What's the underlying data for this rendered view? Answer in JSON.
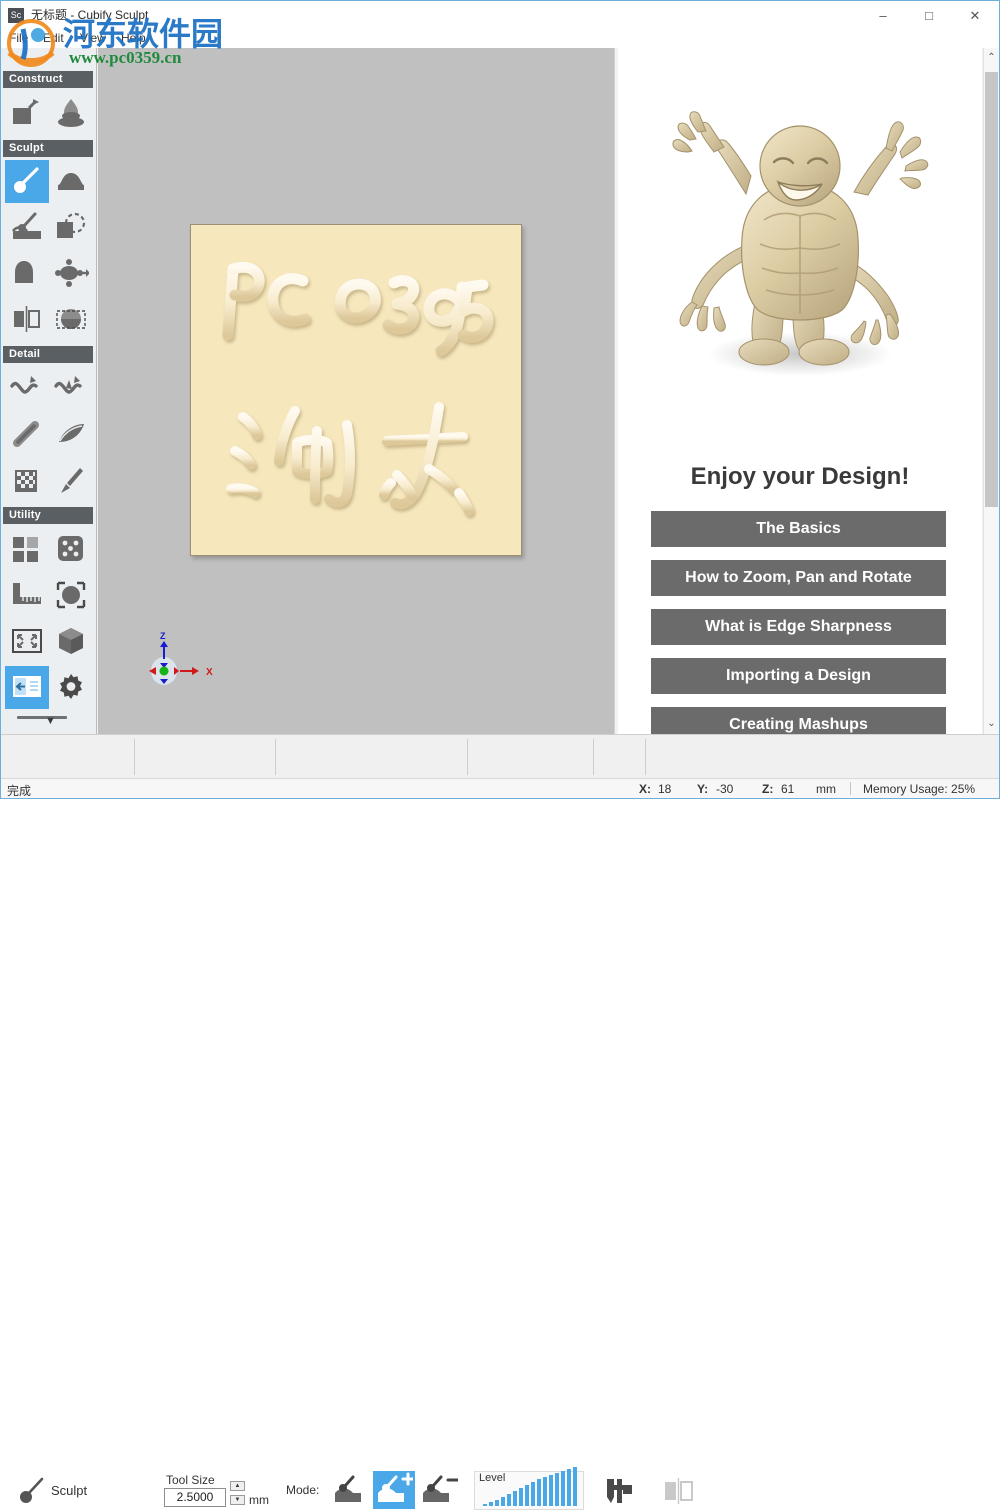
{
  "window": {
    "title": "无标题 - Cubify Sculpt",
    "app_icon": "sculpt-app-icon",
    "minimize": "–",
    "maximize": "□",
    "close": "✕"
  },
  "menu": {
    "items": [
      "File",
      "Edit",
      "View",
      "Help"
    ]
  },
  "watermark": {
    "site_name": "河东软件园",
    "url": "www.pc0359.cn"
  },
  "toolpanel": {
    "sections": [
      {
        "title": "Construct",
        "tools": [
          {
            "name": "import-model-icon",
            "active": false
          },
          {
            "name": "clay-blob-icon",
            "active": false
          }
        ]
      },
      {
        "title": "Sculpt",
        "tools": [
          {
            "name": "sculpt-brush-icon",
            "active": true
          },
          {
            "name": "smooth-mound-icon",
            "active": false
          },
          {
            "name": "carve-tool-icon",
            "active": false
          },
          {
            "name": "select-sphere-icon",
            "active": false
          },
          {
            "name": "inflate-tool-icon",
            "active": false
          },
          {
            "name": "move-transform-icon",
            "active": false
          },
          {
            "name": "mirror-tool-icon",
            "active": false
          },
          {
            "name": "crop-dome-icon",
            "active": false
          }
        ]
      },
      {
        "title": "Detail",
        "tools": [
          {
            "name": "smooth-curve-icon",
            "active": false
          },
          {
            "name": "sharpen-curve-icon",
            "active": false
          },
          {
            "name": "tube-stroke-icon",
            "active": false
          },
          {
            "name": "flatten-blade-icon",
            "active": false
          },
          {
            "name": "texture-checker-icon",
            "active": false
          },
          {
            "name": "paint-brush-icon",
            "active": false
          }
        ]
      },
      {
        "title": "Utility",
        "tools": [
          {
            "name": "grid-layout-icon",
            "active": false
          },
          {
            "name": "dice-randomize-icon",
            "active": false
          },
          {
            "name": "measure-ruler-icon",
            "active": false
          },
          {
            "name": "scale-object-icon",
            "active": false
          },
          {
            "name": "fit-view-icon",
            "active": false
          },
          {
            "name": "cube-solid-icon",
            "active": false
          },
          {
            "name": "collapse-panel-icon",
            "active": true
          },
          {
            "name": "settings-gear-icon",
            "active": false
          }
        ]
      }
    ],
    "collapse_handle": "panel-drag-handle",
    "expand_chevron": "▼"
  },
  "viewport": {
    "model_text_line1": "PC0395",
    "model_text_line2": "河东",
    "gizmo": {
      "z_label": "Z",
      "x_label": "X"
    }
  },
  "helppanel": {
    "model_name": "clay-monster-model",
    "title": "Enjoy your Design!",
    "buttons": [
      "The Basics",
      "How to Zoom, Pan and Rotate",
      "What is Edge Sharpness",
      "Importing a Design",
      "Creating Mashups"
    ],
    "scrollbar": {
      "up": "⌃",
      "down": "⌄"
    }
  },
  "bottombar": {
    "tool_icon": "sculpt-brush-icon",
    "tool_name": "Sculpt",
    "toolsize_label": "Tool Size",
    "toolsize_value": "2.5000",
    "toolsize_unit": "mm",
    "spin_up": "▲",
    "spin_down": "▼",
    "mode_label": "Mode:",
    "modes": [
      {
        "name": "mode-sculpt-icon",
        "active": false
      },
      {
        "name": "mode-add-icon",
        "active": true
      },
      {
        "name": "mode-subtract-icon",
        "active": false
      }
    ],
    "level_label": "Level",
    "level_values": [
      2,
      4,
      6,
      9,
      12,
      15,
      18,
      21,
      24,
      27,
      29,
      31,
      33,
      35,
      37,
      39
    ],
    "caliper_icon": "caliper-measure-icon",
    "mirror_icon": "mirror-view-icon"
  },
  "statusbar": {
    "message": "完成",
    "x_label": "X:",
    "x_value": "18",
    "y_label": "Y:",
    "y_value": "-30",
    "z_label": "Z:",
    "z_value": "61",
    "unit": "mm",
    "memory": "Memory Usage: 25%"
  },
  "colors": {
    "accent": "#4aa8e8",
    "section_header": "#5a5f63",
    "help_button": "#6b6b6b",
    "clay": "#f6e7bd",
    "viewport_bg": "#c0c0c0"
  }
}
